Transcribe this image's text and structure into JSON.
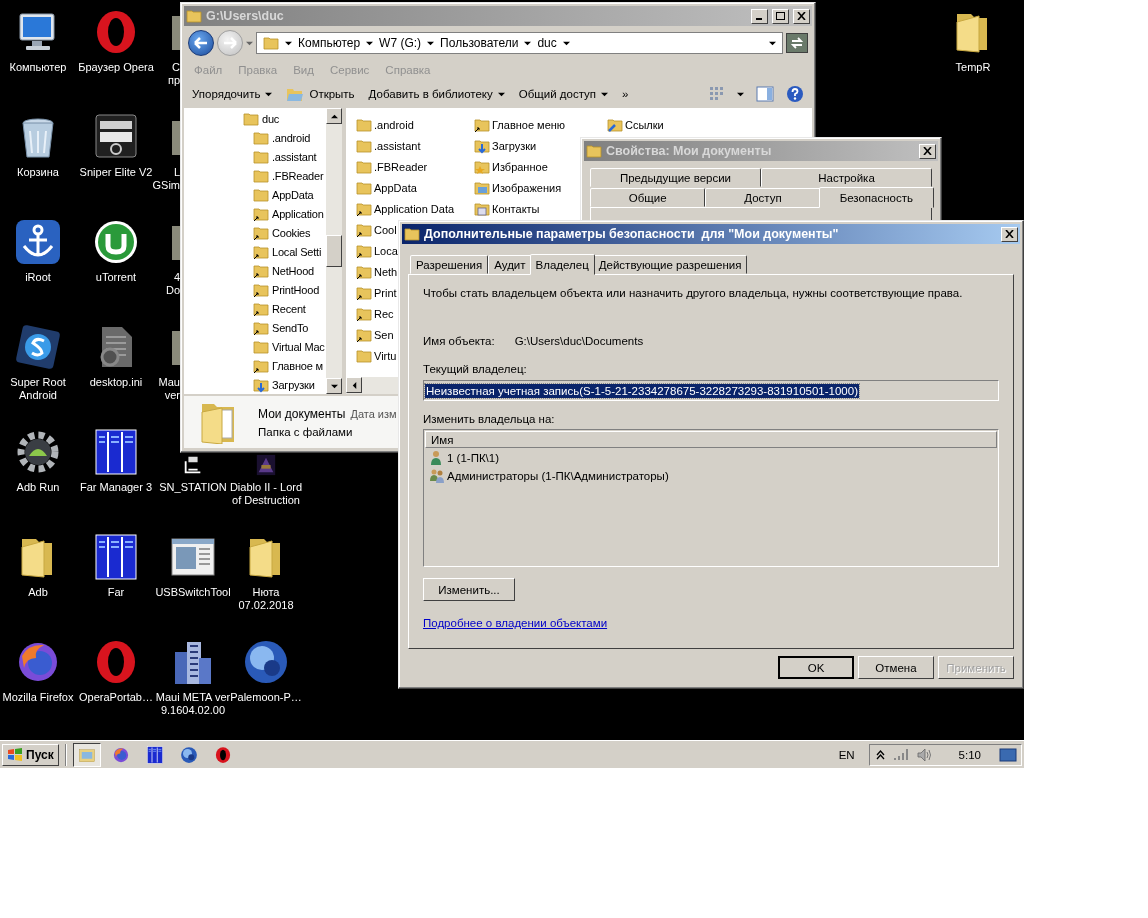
{
  "desktop": {
    "columns": [
      [
        {
          "label": [
            "Компьютер"
          ],
          "kind": "computer"
        },
        {
          "label": [
            "Корзина"
          ],
          "kind": "recycle"
        },
        {
          "label": [
            "iRoot"
          ],
          "kind": "anchor"
        },
        {
          "label": [
            "Super Root",
            "Android"
          ],
          "kind": "superroot"
        },
        {
          "label": [
            "Adb Run"
          ],
          "kind": "android"
        },
        {
          "label": [
            "Adb"
          ],
          "kind": "folder"
        },
        {
          "label": [
            "Mozilla Firefox"
          ],
          "kind": "firefox"
        }
      ],
      [
        {
          "label": [
            "Браузер Opera"
          ],
          "kind": "opera"
        },
        {
          "label": [
            "Sniper Elite V2"
          ],
          "kind": "sniper"
        },
        {
          "label": [
            "uTorrent"
          ],
          "kind": "utorrent"
        },
        {
          "label": [
            "desktop.ini"
          ],
          "kind": "file"
        },
        {
          "label": [
            "Far Manager 3"
          ],
          "kind": "far"
        },
        {
          "label": [
            "Far"
          ],
          "kind": "far"
        },
        {
          "label": [
            "OperaPortab…"
          ],
          "kind": "opera"
        }
      ],
      [
        {
          "label": [
            "С",
            "пр"
          ],
          "kind": "covered"
        },
        {
          "label": [
            "L",
            "GSim"
          ],
          "kind": "covered"
        },
        {
          "label": [
            "4",
            "Do"
          ],
          "kind": "covered"
        },
        {
          "label": [
            "Mau",
            "ver"
          ],
          "kind": "covered"
        },
        {
          "label": [
            "SN_STATION"
          ],
          "kind": "station"
        },
        {
          "label": [
            "USBSwitchTool"
          ],
          "kind": "window"
        },
        {
          "label": [
            "Maui META ver",
            "9.1604.02.00"
          ],
          "kind": "building"
        }
      ],
      [
        {
          "label": [
            "Diablo II - Lord",
            "of Destruction"
          ],
          "kind": "game"
        },
        {
          "label": [
            "Нюта",
            "07.02.2018"
          ],
          "kind": "folder"
        },
        {
          "label": [
            "Palemoon-P…"
          ],
          "kind": "palemoon"
        }
      ]
    ],
    "corner_icon": {
      "label": [
        "TempR"
      ],
      "kind": "folder"
    }
  },
  "explorer": {
    "title": "G:\\Users\\duc",
    "breadcrumbs": [
      "Компьютер",
      "W7 (G:)",
      "Пользователи",
      "duc"
    ],
    "menu": [
      "Файл",
      "Правка",
      "Вид",
      "Сервис",
      "Справка"
    ],
    "toolbar": [
      {
        "label": "Упорядочить",
        "kind": "dropdown"
      },
      {
        "label": "Открыть",
        "kind": "open"
      },
      {
        "label": "Добавить в библиотеку",
        "kind": "dropdown"
      },
      {
        "label": "Общий доступ",
        "kind": "dropdown"
      },
      {
        "label": "»",
        "kind": "plain"
      }
    ],
    "tree": [
      {
        "label": "duc",
        "kind": "folder",
        "children": [
          {
            "label": ".android",
            "kind": "folder"
          },
          {
            "label": ".assistant",
            "kind": "folder"
          },
          {
            "label": ".FBReader",
            "kind": "folder"
          },
          {
            "label": "AppData",
            "kind": "folder"
          },
          {
            "label": "Application",
            "kind": "shortcut"
          },
          {
            "label": "Cookies",
            "kind": "shortcut"
          },
          {
            "label": "Local Setti",
            "kind": "shortcut"
          },
          {
            "label": "NetHood",
            "kind": "shortcut"
          },
          {
            "label": "PrintHood",
            "kind": "shortcut"
          },
          {
            "label": "Recent",
            "kind": "shortcut"
          },
          {
            "label": "SendTo",
            "kind": "shortcut"
          },
          {
            "label": "Virtual Mac",
            "kind": "folder"
          },
          {
            "label": "Главное м",
            "kind": "shortcut"
          },
          {
            "label": "Загрузки",
            "kind": "downloads"
          }
        ]
      }
    ],
    "item_columns": [
      [
        {
          "label": ".android",
          "kind": "folder"
        },
        {
          "label": ".assistant",
          "kind": "folder"
        },
        {
          "label": ".FBReader",
          "kind": "folder"
        },
        {
          "label": "AppData",
          "kind": "folder"
        },
        {
          "label": "Application Data",
          "kind": "shortcut"
        },
        {
          "label": "Cool",
          "kind": "shortcut"
        },
        {
          "label": "Loca",
          "kind": "shortcut"
        },
        {
          "label": "Neth",
          "kind": "shortcut"
        },
        {
          "label": "Print",
          "kind": "shortcut"
        },
        {
          "label": "Rec",
          "kind": "shortcut"
        },
        {
          "label": "Sen",
          "kind": "shortcut"
        },
        {
          "label": "Virtu",
          "kind": "folder"
        }
      ],
      [
        {
          "label": "Главное меню",
          "kind": "shortcut"
        },
        {
          "label": "Загрузки",
          "kind": "downloads"
        },
        {
          "label": "Избранное",
          "kind": "favorites"
        },
        {
          "label": "Изображения",
          "kind": "pictures"
        },
        {
          "label": "Контакты",
          "kind": "contacts"
        }
      ],
      [
        {
          "label": "Ссылки",
          "kind": "links"
        }
      ]
    ],
    "details": {
      "name": "Мои документы",
      "meta": "Дата изм",
      "type": "Папка с файлами"
    }
  },
  "properties": {
    "title": "Свойства: Мои документы",
    "tab_rows": [
      [
        {
          "label": "Предыдущие версии",
          "selected": false
        },
        {
          "label": "Настройка",
          "selected": false
        }
      ],
      [
        {
          "label": "Общие",
          "selected": false
        },
        {
          "label": "Доступ",
          "selected": false
        },
        {
          "label": "Безопасность",
          "selected": true
        }
      ]
    ]
  },
  "security": {
    "title": "Дополнительные параметры безопасности  для \"Мои документы\"",
    "tabs": [
      {
        "label": "Разрешения",
        "selected": false
      },
      {
        "label": "Аудит",
        "selected": false
      },
      {
        "label": "Владелец",
        "selected": true
      },
      {
        "label": "Действующие разрешения",
        "selected": false
      }
    ],
    "intro": "Чтобы стать владельцем объекта или назначить другого владельца, нужны соответствующие права.",
    "object_label": "Имя объекта:",
    "object_value": "G:\\Users\\duc\\Documents",
    "owner_label": "Текущий владелец:",
    "owner_value": "Неизвестная учетная запись(S-1-5-21-2334278675-3228273293-831910501-1000)",
    "owner_selected": true,
    "change_label": "Изменить владельца на:",
    "list_header": "Имя",
    "owners": [
      {
        "name": "1 (1-ПК\\1)",
        "kind": "user"
      },
      {
        "name": "Администраторы (1-ПК\\Администраторы)",
        "kind": "group"
      }
    ],
    "change_button": "Изменить...",
    "link": "Подробнее о владении объектами",
    "buttons": [
      {
        "label": "OK",
        "default": true,
        "disabled": false
      },
      {
        "label": "Отмена",
        "default": false,
        "disabled": false
      },
      {
        "label": "Применить",
        "default": false,
        "disabled": true
      }
    ]
  },
  "taskbar": {
    "start": "Пуск",
    "quick_launch": [
      {
        "kind": "explorer",
        "active": true
      },
      {
        "kind": "firefox",
        "active": false
      },
      {
        "kind": "far",
        "active": false
      },
      {
        "kind": "palemoon",
        "active": false
      },
      {
        "kind": "opera",
        "active": false
      }
    ],
    "language": "EN",
    "clock": "5:10"
  }
}
